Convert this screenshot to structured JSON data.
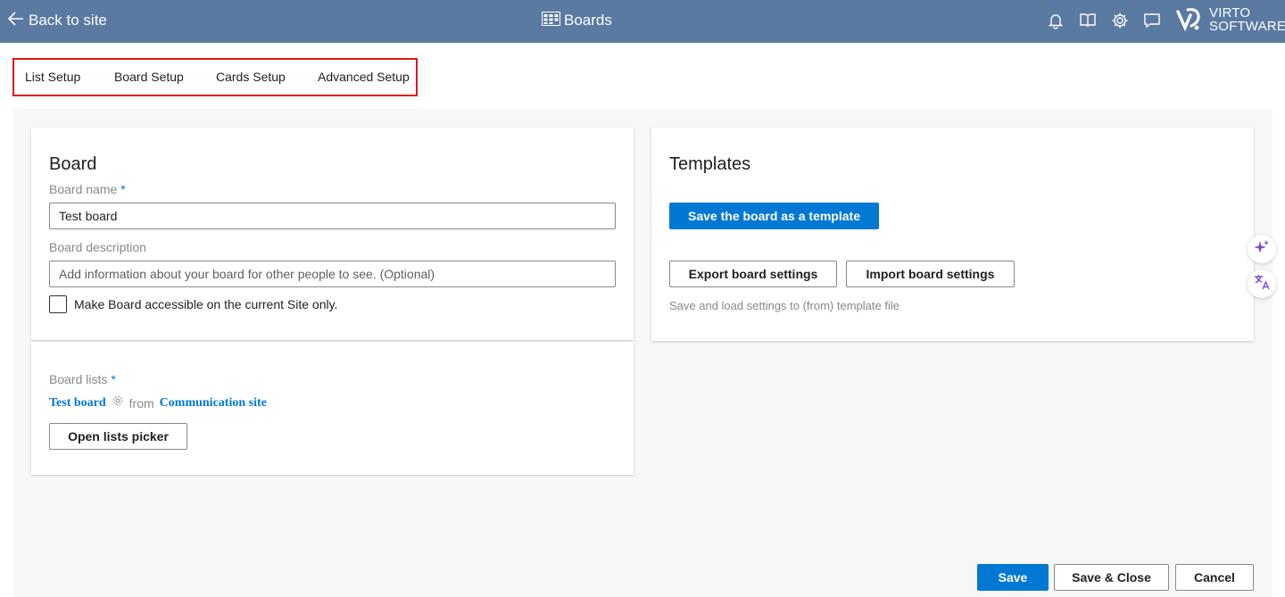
{
  "header": {
    "back_label": "Back to site",
    "title": "Boards",
    "icons": [
      "bell-icon",
      "book-icon",
      "gear-icon",
      "feedback-icon"
    ],
    "logo": {
      "line1": "VIRTO",
      "line2": "SOFTWARE"
    }
  },
  "tabs": [
    {
      "label": "List Setup",
      "active": true
    },
    {
      "label": "Board Setup",
      "active": false
    },
    {
      "label": "Cards Setup",
      "active": false
    },
    {
      "label": "Advanced Setup",
      "active": false
    }
  ],
  "board_card": {
    "title": "Board",
    "name_label": "Board name",
    "required_mark": "*",
    "name_value": "Test board",
    "description_label": "Board description",
    "description_placeholder": "Add information about your board for other people to see. (Optional)",
    "checkbox_label": "Make Board accessible on the current Site only.",
    "checkbox_checked": false
  },
  "lists_card": {
    "label": "Board lists",
    "required_mark": "*",
    "list_name": "Test board",
    "from_text": "from",
    "site_name": "Communication site",
    "picker_button": "Open lists picker"
  },
  "templates_card": {
    "title": "Templates",
    "save_template_button": "Save the board as a template",
    "export_button": "Export board settings",
    "import_button": "Import board settings",
    "hint": "Save and load settings to (from) template file"
  },
  "footer": {
    "save": "Save",
    "save_close": "Save & Close",
    "cancel": "Cancel"
  },
  "colors": {
    "header_bg": "#5a7aa1",
    "accent": "#0078d4",
    "highlight_border": "#e0151b"
  }
}
